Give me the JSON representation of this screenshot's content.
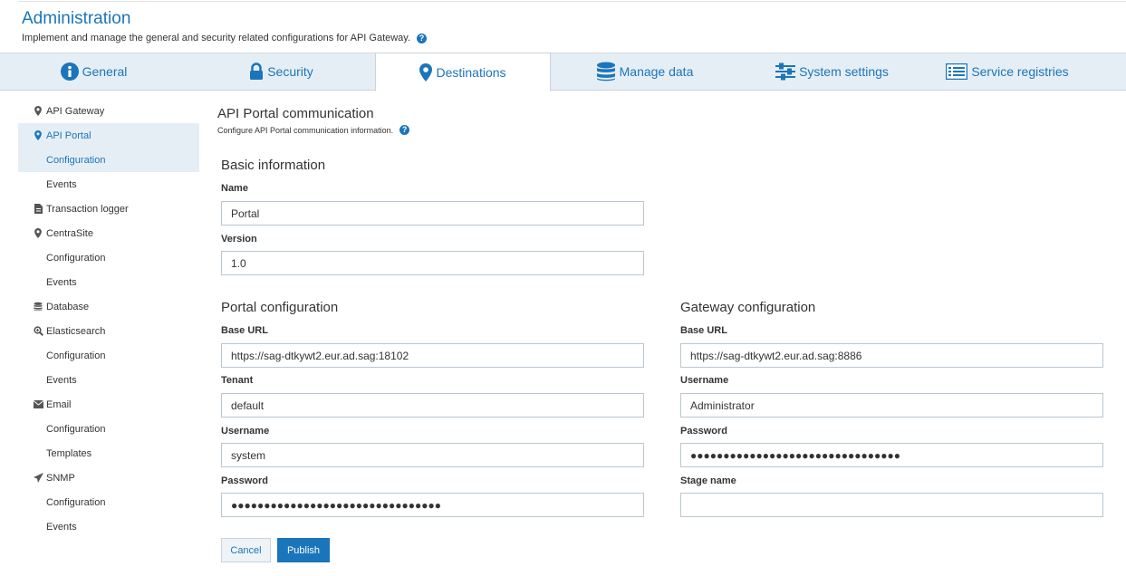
{
  "header": {
    "title": "Administration",
    "subtitle": "Implement and manage the general and security related configurations for API Gateway."
  },
  "tabs": [
    {
      "label": "General",
      "icon": "info-icon"
    },
    {
      "label": "Security",
      "icon": "lock-icon"
    },
    {
      "label": "Destinations",
      "icon": "map-marker-icon",
      "active": true
    },
    {
      "label": "Manage data",
      "icon": "database-icon"
    },
    {
      "label": "System settings",
      "icon": "sliders-icon"
    },
    {
      "label": "Service registries",
      "icon": "list-icon"
    }
  ],
  "sidebar": {
    "items": [
      {
        "label": "API Gateway",
        "icon": "map-marker-icon"
      },
      {
        "label": "API Portal",
        "icon": "map-marker-icon"
      },
      {
        "label": "Configuration"
      },
      {
        "label": "Events"
      },
      {
        "label": "Transaction logger",
        "icon": "document-icon"
      },
      {
        "label": "CentraSite",
        "icon": "map-marker-icon"
      },
      {
        "label": "Configuration"
      },
      {
        "label": "Events"
      },
      {
        "label": "Database",
        "icon": "database-icon"
      },
      {
        "label": "Elasticsearch",
        "icon": "search-icon"
      },
      {
        "label": "Configuration"
      },
      {
        "label": "Events"
      },
      {
        "label": "Email",
        "icon": "envelope-icon"
      },
      {
        "label": "Configuration"
      },
      {
        "label": "Templates"
      },
      {
        "label": "SNMP",
        "icon": "paper-plane-icon"
      },
      {
        "label": "Configuration"
      },
      {
        "label": "Events"
      }
    ]
  },
  "main": {
    "title": "API Portal communication",
    "description": "Configure API Portal communication information.",
    "basic": {
      "title": "Basic information",
      "name_label": "Name",
      "name_value": "Portal",
      "version_label": "Version",
      "version_value": "1.0"
    },
    "portal": {
      "title": "Portal configuration",
      "base_url_label": "Base URL",
      "base_url_value": "https://sag-dtkywt2.eur.ad.sag:18102",
      "tenant_label": "Tenant",
      "tenant_value": "default",
      "username_label": "Username",
      "username_value": "system",
      "password_label": "Password",
      "password_value": "●●●●●●●●●●●●●●●●●●●●●●●●●●●●●●●●"
    },
    "gateway": {
      "title": "Gateway configuration",
      "base_url_label": "Base URL",
      "base_url_value": "https://sag-dtkywt2.eur.ad.sag:8886",
      "username_label": "Username",
      "username_value": "Administrator",
      "password_label": "Password",
      "password_value": "●●●●●●●●●●●●●●●●●●●●●●●●●●●●●●●●",
      "stage_label": "Stage name",
      "stage_value": ""
    },
    "buttons": {
      "cancel": "Cancel",
      "publish": "Publish"
    }
  },
  "colors": {
    "accent": "#1b75bb",
    "tabbar_bg": "#e6eef5",
    "sidebar_highlight": "#e6eef5"
  }
}
